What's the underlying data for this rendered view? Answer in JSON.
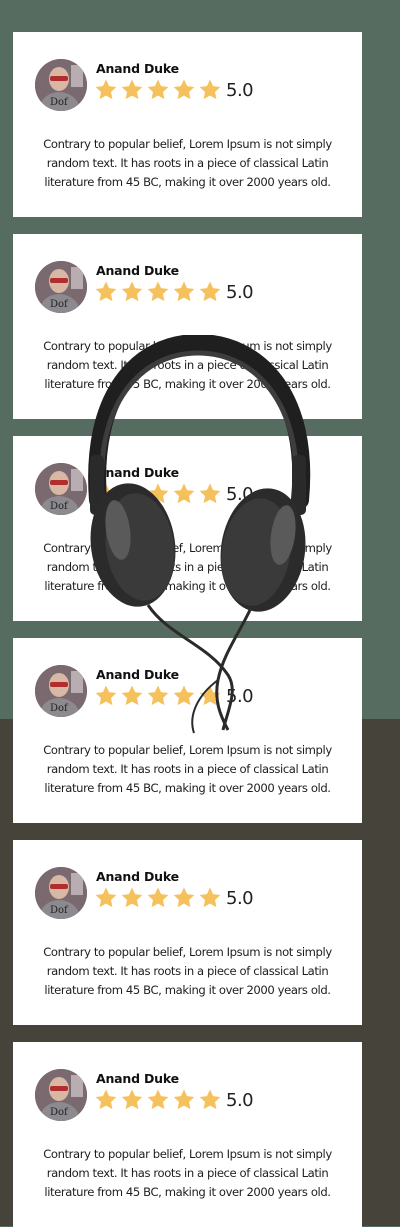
{
  "testimonials": [
    {
      "name": "Anand Duke",
      "rating": "5.0",
      "stars": 5,
      "text": "Contrary to popular belief, Lorem Ipsum is not simply random text. It has roots in a piece of classical Latin literature from 45 BC, making it over 2000 years old."
    },
    {
      "name": "Anand Duke",
      "rating": "5.0",
      "stars": 5,
      "text": "Contrary to popular belief, Lorem Ipsum is not simply random text. It has roots in a piece of classical Latin literature from 45 BC, making it over 2000 years old."
    },
    {
      "name": "Anand Duke",
      "rating": "5.0",
      "stars": 5,
      "text": "Contrary to popular belief, Lorem Ipsum is not simply random text. It has roots in a piece of classical Latin literature from 45 BC, making it over 2000 years old."
    },
    {
      "name": "Anand Duke",
      "rating": "5.0",
      "stars": 5,
      "text": "Contrary to popular belief, Lorem Ipsum is not simply random text. It has roots in a piece of classical Latin literature from 45 BC, making it over 2000 years old."
    },
    {
      "name": "Anand Duke",
      "rating": "5.0",
      "stars": 5,
      "text": "Contrary to popular belief, Lorem Ipsum is not simply random text. It has roots in a piece of classical Latin literature from 45 BC, making it over 2000 years old."
    },
    {
      "name": "Anand Duke",
      "rating": "5.0",
      "stars": 5,
      "text": "Contrary to popular belief, Lorem Ipsum is not simply random text. It has roots in a piece of classical Latin literature from 45 BC, making it over 2000 years old."
    }
  ],
  "colors": {
    "background_top": "#566c61",
    "background_bottom": "#46433b",
    "card": "#ffffff",
    "star": "#f5c15c",
    "text": "#1e1e1e"
  },
  "icons": {
    "star": "star-icon",
    "decoration": "headphones-icon"
  }
}
